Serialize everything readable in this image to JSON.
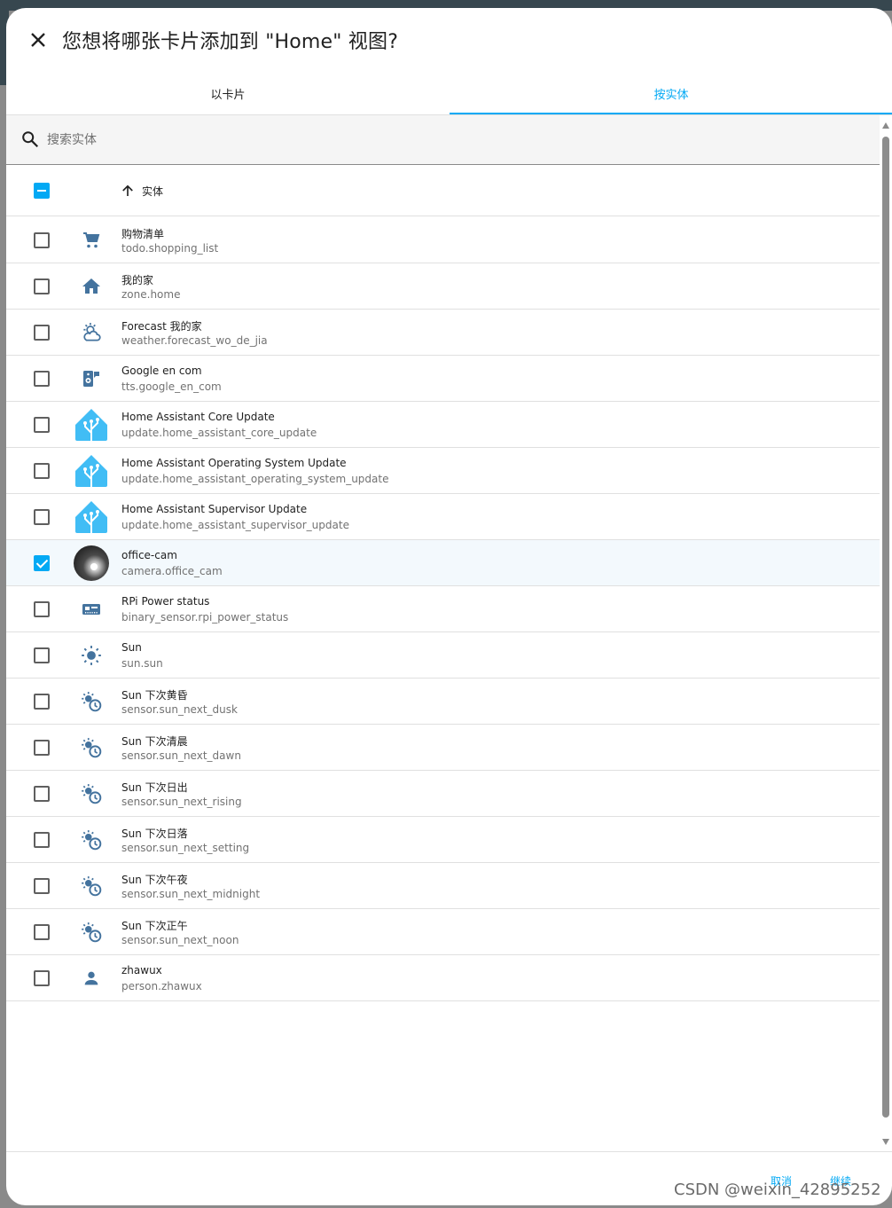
{
  "dialog": {
    "title": "您想将哪张卡片添加到 \"Home\" 视图?",
    "close_icon": "close-icon"
  },
  "tabs": [
    {
      "label": "以卡片",
      "active": false
    },
    {
      "label": "按实体",
      "active": true
    }
  ],
  "search": {
    "placeholder": "搜索实体",
    "value": ""
  },
  "table": {
    "header_label": "实体",
    "select_all_state": "indeterminate",
    "rows": [
      {
        "name": "购物清单",
        "entity_id": "todo.shopping_list",
        "icon": "cart-icon",
        "checked": false
      },
      {
        "name": "我的家",
        "entity_id": "zone.home",
        "icon": "home-icon",
        "checked": false
      },
      {
        "name": "Forecast 我的家",
        "entity_id": "weather.forecast_wo_de_jia",
        "icon": "weather-partly-cloudy-icon",
        "checked": false
      },
      {
        "name": "Google en com",
        "entity_id": "tts.google_en_com",
        "icon": "speaker-message-icon",
        "checked": false
      },
      {
        "name": "Home Assistant Core Update",
        "entity_id": "update.home_assistant_core_update",
        "icon": "home-assistant-logo",
        "checked": false
      },
      {
        "name": "Home Assistant Operating System Update",
        "entity_id": "update.home_assistant_operating_system_update",
        "icon": "home-assistant-logo",
        "checked": false
      },
      {
        "name": "Home Assistant Supervisor Update",
        "entity_id": "update.home_assistant_supervisor_update",
        "icon": "home-assistant-logo",
        "checked": false
      },
      {
        "name": "office-cam",
        "entity_id": "camera.office_cam",
        "icon": "camera-thumbnail",
        "checked": true
      },
      {
        "name": "RPi Power status",
        "entity_id": "binary_sensor.rpi_power_status",
        "icon": "raspberry-pi-icon",
        "checked": false
      },
      {
        "name": "Sun",
        "entity_id": "sun.sun",
        "icon": "sun-icon",
        "checked": false
      },
      {
        "name": "Sun 下次黄昏",
        "entity_id": "sensor.sun_next_dusk",
        "icon": "sun-clock-icon",
        "checked": false
      },
      {
        "name": "Sun 下次清晨",
        "entity_id": "sensor.sun_next_dawn",
        "icon": "sun-clock-icon",
        "checked": false
      },
      {
        "name": "Sun 下次日出",
        "entity_id": "sensor.sun_next_rising",
        "icon": "sun-clock-icon",
        "checked": false
      },
      {
        "name": "Sun 下次日落",
        "entity_id": "sensor.sun_next_setting",
        "icon": "sun-clock-icon",
        "checked": false
      },
      {
        "name": "Sun 下次午夜",
        "entity_id": "sensor.sun_next_midnight",
        "icon": "sun-clock-icon",
        "checked": false
      },
      {
        "name": "Sun 下次正午",
        "entity_id": "sensor.sun_next_noon",
        "icon": "sun-clock-icon",
        "checked": false
      },
      {
        "name": "zhawux",
        "entity_id": "person.zhawux",
        "icon": "person-icon",
        "checked": false
      }
    ]
  },
  "footer": {
    "cancel_label": "取消",
    "continue_label": "继续"
  },
  "watermark": "CSDN @weixin_42895252",
  "colors": {
    "accent": "#03a9f4",
    "icon": "#44739e",
    "ha_logo": "#41bdf5"
  }
}
